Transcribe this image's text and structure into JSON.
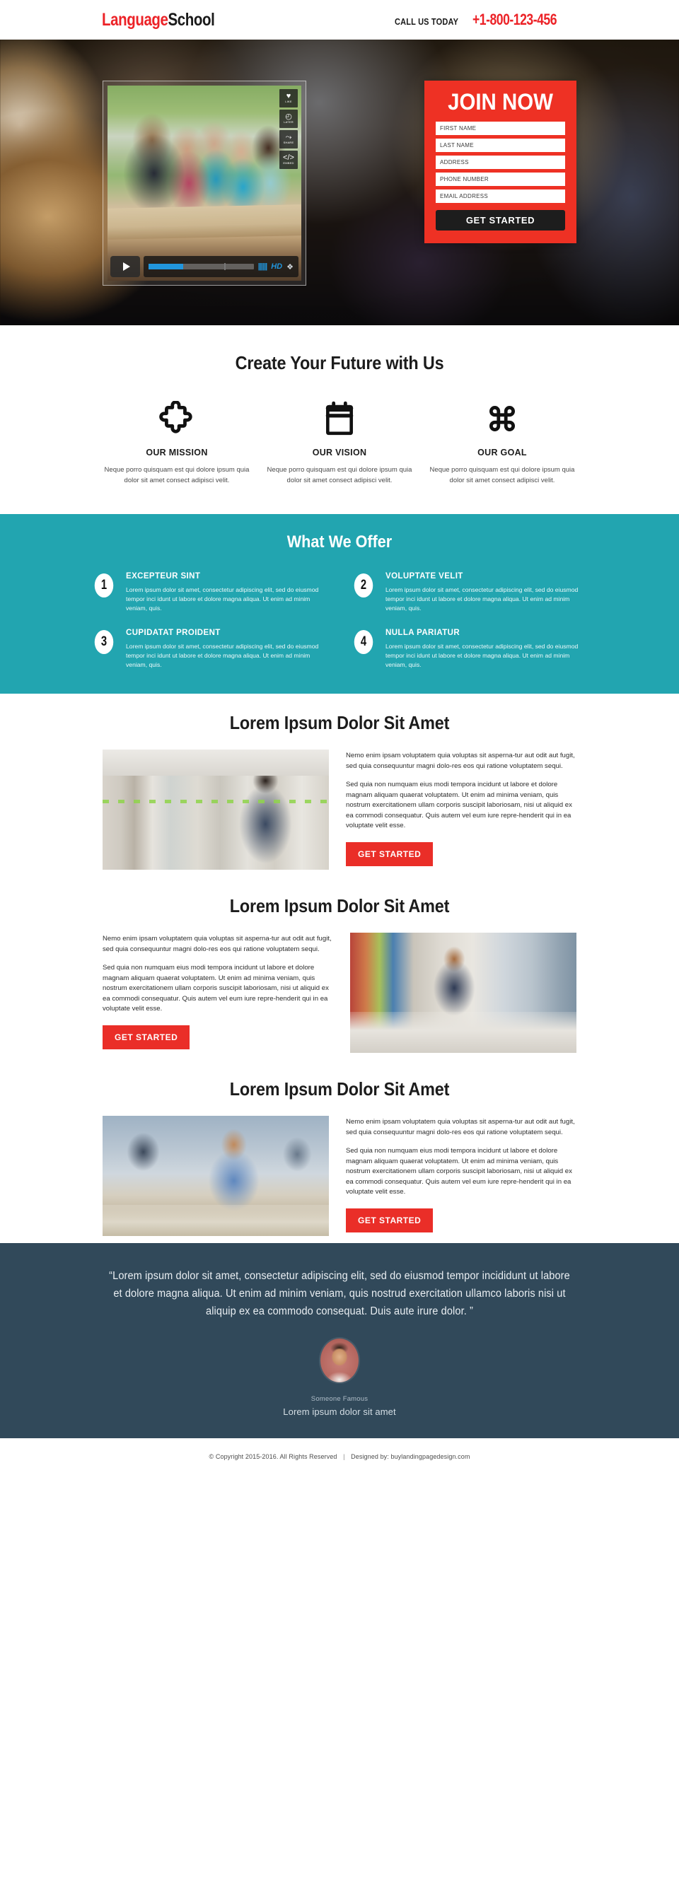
{
  "header": {
    "logo_part1": "Language",
    "logo_part2": "School",
    "call_label": "CALL US TODAY",
    "phone": "+1-800-123-456"
  },
  "hero": {
    "video": {
      "actions": [
        {
          "icon": "heart-icon",
          "glyph": "♥",
          "label": "LIKE"
        },
        {
          "icon": "clock-icon",
          "glyph": "◴",
          "label": "LATER"
        },
        {
          "icon": "share-icon",
          "glyph": "⤳",
          "label": "SHARE"
        },
        {
          "icon": "code-icon",
          "glyph": "</>",
          "label": "EMBED"
        }
      ],
      "play_label": "play",
      "quality_label": "HD",
      "progress_percent": 33
    },
    "form": {
      "title": "JOIN NOW",
      "fields": [
        {
          "name": "first-name",
          "placeholder": "FIRST NAME",
          "value": ""
        },
        {
          "name": "last-name",
          "placeholder": "LAST NAME",
          "value": ""
        },
        {
          "name": "address",
          "placeholder": "ADDRESS",
          "value": ""
        },
        {
          "name": "phone-number",
          "placeholder": "PHONE NUMBER",
          "value": ""
        },
        {
          "name": "email-address",
          "placeholder": "EMAIL ADDRESS",
          "value": ""
        }
      ],
      "submit_label": "GET STARTED"
    }
  },
  "features": {
    "title": "Create Your Future with Us",
    "items": [
      {
        "icon": "puzzle-piece-icon",
        "title": "OUR MISSION",
        "text": "Neque porro quisquam est qui dolore ipsum quia dolor sit amet consect adipisci velit."
      },
      {
        "icon": "clipboard-calendar-icon",
        "title": "OUR VISION",
        "text": "Neque porro quisquam est qui dolore ipsum quia dolor sit amet consect adipisci velit."
      },
      {
        "icon": "command-loop-icon",
        "title": "OUR GOAL",
        "text": "Neque porro quisquam est qui dolore ipsum quia dolor sit amet consect adipisci velit."
      }
    ]
  },
  "offer": {
    "title": "What We Offer",
    "bg_color": "#22a5b0",
    "items": [
      {
        "number": "1",
        "title": "EXCEPTEUR SINT",
        "text": "Lorem ipsum dolor sit amet, consectetur adipiscing elit, sed do eiusmod tempor inci idunt ut labore et dolore magna aliqua. Ut enim ad minim veniam, quis."
      },
      {
        "number": "2",
        "title": "VOLUPTATE VELIT",
        "text": "Lorem ipsum dolor sit amet, consectetur adipiscing elit, sed do eiusmod tempor inci idunt ut labore et dolore magna aliqua. Ut enim ad minim veniam, quis."
      },
      {
        "number": "3",
        "title": "CUPIDATAT PROIDENT",
        "text": "Lorem ipsum dolor sit amet, consectetur adipiscing elit, sed do eiusmod tempor inci idunt ut labore et dolore magna aliqua. Ut enim ad minim veniam, quis."
      },
      {
        "number": "4",
        "title": "NULLA PARIATUR",
        "text": "Lorem ipsum dolor sit amet, consectetur adipiscing elit, sed do eiusmod tempor inci idunt ut labore et dolore magna aliqua. Ut enim ad minim veniam, quis."
      }
    ]
  },
  "blocks": [
    {
      "title": "Lorem Ipsum Dolor Sit Amet",
      "image": "student-reaching-for-book-in-library",
      "paragraph1": "Nemo enim ipsam voluptatem quia voluptas sit asperna-tur aut odit aut fugit, sed quia consequuntur magni dolo-res eos qui ratione voluptatem sequi.",
      "paragraph2": "Sed quia non numquam eius modi tempora incidunt ut labore et dolore magnam aliquam quaerat voluptatem. Ut enim ad minima veniam, quis nostrum exercitationem ullam corporis suscipit laboriosam, nisi ut aliquid ex ea commodi consequatur. Quis autem vel eum iure repre-henderit qui in ea voluptate velit esse.",
      "cta_label": "GET STARTED"
    },
    {
      "title": "Lorem Ipsum Dolor Sit Amet",
      "image": "student-studying-at-library-desk",
      "paragraph1": "Nemo enim ipsam voluptatem quia voluptas sit asperna-tur aut odit aut fugit, sed quia consequuntur magni dolo-res eos qui ratione voluptatem sequi.",
      "paragraph2": "Sed quia non numquam eius modi tempora incidunt ut labore et dolore magnam aliquam quaerat voluptatem. Ut enim ad minima veniam, quis nostrum exercitationem ullam corporis suscipit laboriosam, nisi ut aliquid ex ea commodi consequatur. Quis autem vel eum iure repre-henderit qui in ea voluptate velit esse.",
      "cta_label": "GET STARTED"
    },
    {
      "title": "Lorem Ipsum Dolor Sit Amet",
      "image": "students-writing-in-classroom",
      "paragraph1": "Nemo enim ipsam voluptatem quia voluptas sit asperna-tur aut odit aut fugit, sed quia consequuntur magni dolo-res eos qui ratione voluptatem sequi.",
      "paragraph2": "Sed quia non numquam eius modi tempora incidunt ut labore et dolore magnam aliquam quaerat voluptatem. Ut enim ad minima veniam, quis nostrum exercitationem ullam corporis suscipit laboriosam, nisi ut aliquid ex ea commodi consequatur. Quis autem vel eum iure repre-henderit qui in ea voluptate velit esse.",
      "cta_label": "GET STARTED"
    }
  ],
  "testimonial": {
    "bg_color": "#31495a",
    "quote": "“Lorem ipsum dolor sit amet, consectetur adipiscing elit, sed do eiusmod tempor incididunt ut labore et dolore magna aliqua. Ut enim ad minim veniam, quis nostrud exercitation ullamco laboris nisi ut aliquip ex ea commodo consequat. Duis aute irure dolor. ”",
    "avatar": "portrait-of-smiling-man",
    "name": "Someone Famous",
    "subtitle": "Lorem ipsum dolor sit amet"
  },
  "footer": {
    "copyright": "© Copyright 2015-2016. All Rights Reserved",
    "separator": "|",
    "designed_by": "Designed by: buylandingpagedesign.com"
  },
  "theme": {
    "red": "#ea2e28",
    "teal": "#22a5b0",
    "slate": "#31495a",
    "video_blue": "#2196dd"
  }
}
